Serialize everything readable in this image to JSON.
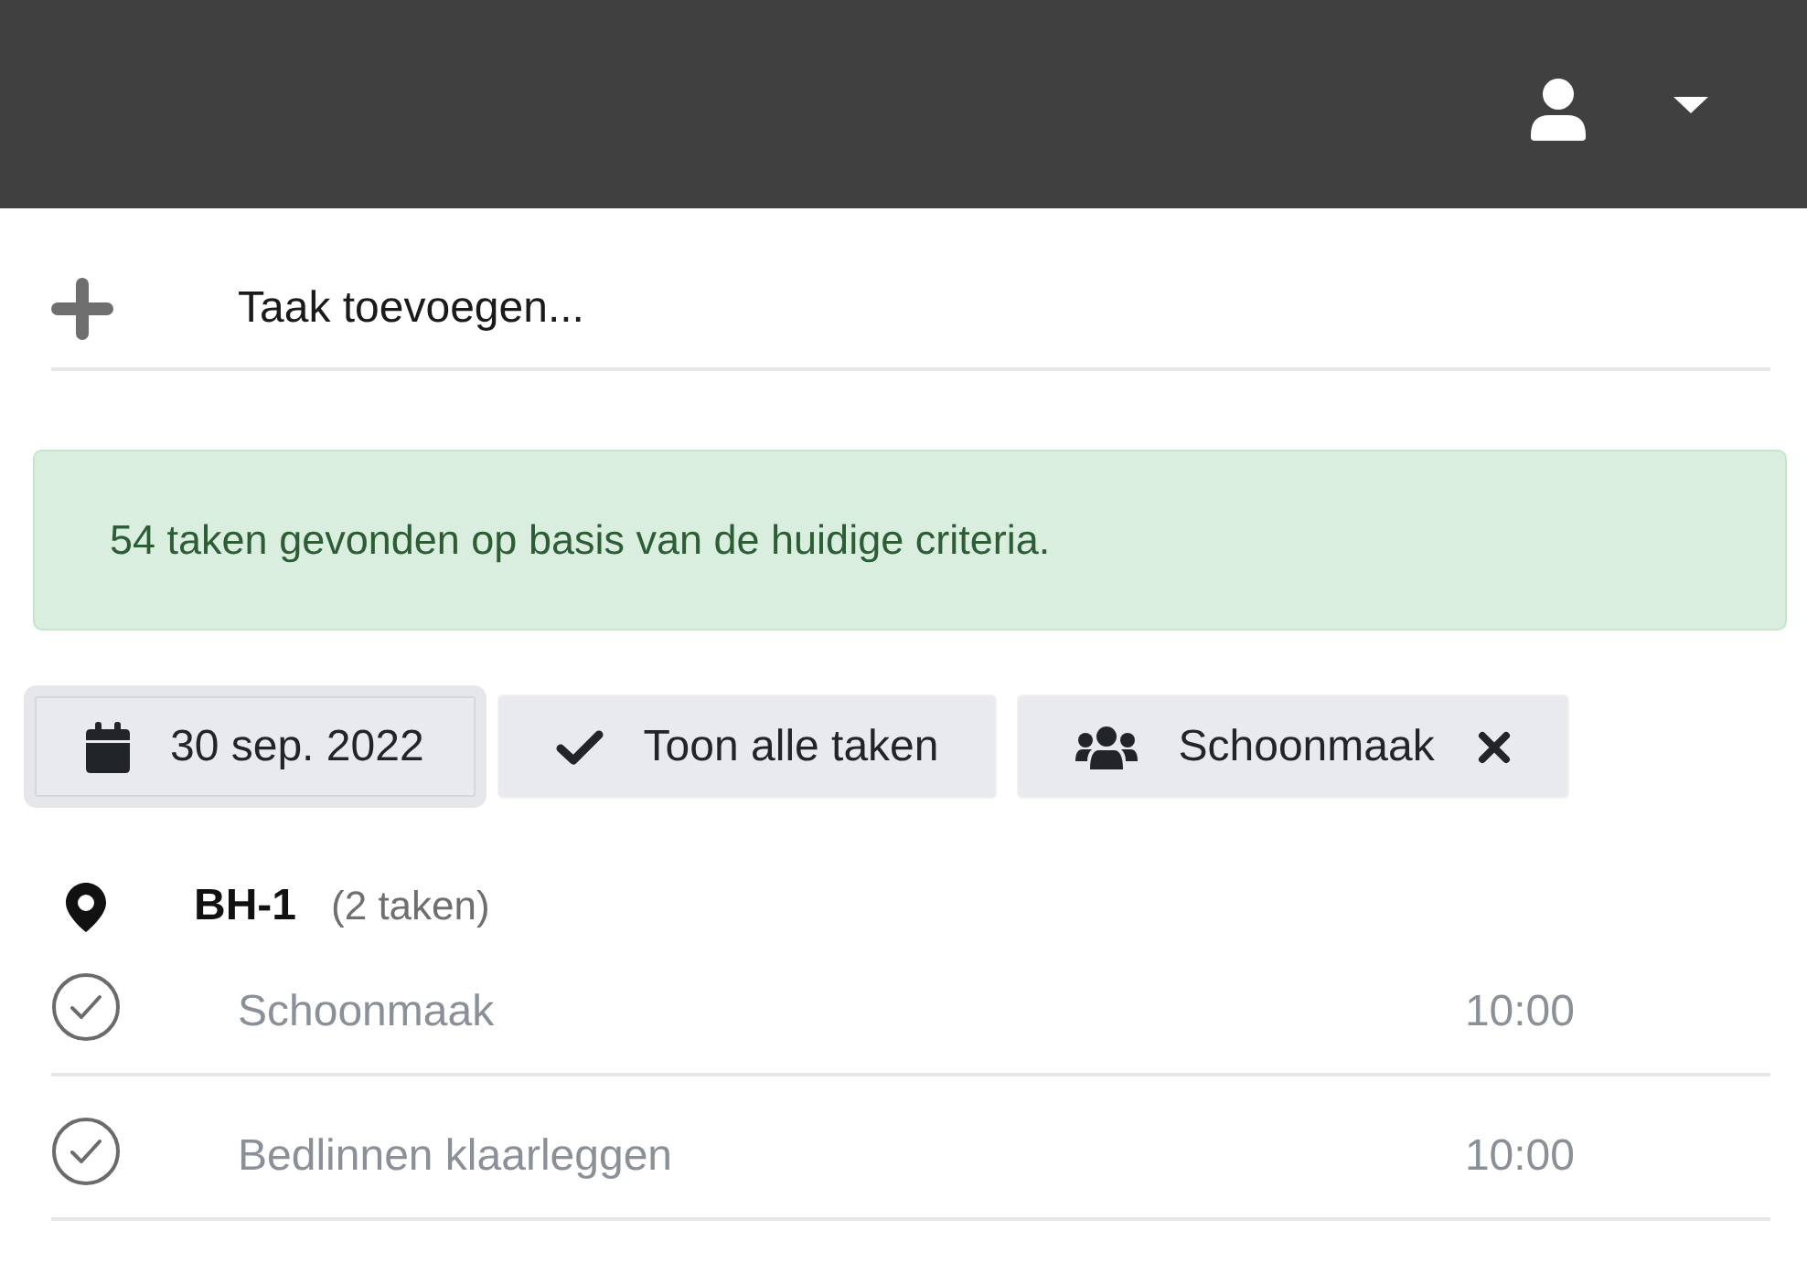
{
  "add_task": {
    "placeholder": "Taak toevoegen..."
  },
  "alert": {
    "kind": "success",
    "text": "54 taken gevonden op basis van de huidige criteria."
  },
  "filters": [
    {
      "kind": "date",
      "label": "30 sep. 2022",
      "focused": true,
      "removable": false
    },
    {
      "kind": "status",
      "label": "Toon alle taken",
      "focused": false,
      "removable": false
    },
    {
      "kind": "group",
      "label": "Schoonmaak",
      "focused": false,
      "removable": true
    }
  ],
  "groups": [
    {
      "name": "BH-1",
      "count": "(2 taken)",
      "tasks": [
        {
          "title": "Schoonmaak",
          "time": "10:00"
        },
        {
          "title": "Bedlinnen klaarleggen",
          "time": "10:00"
        }
      ]
    }
  ]
}
